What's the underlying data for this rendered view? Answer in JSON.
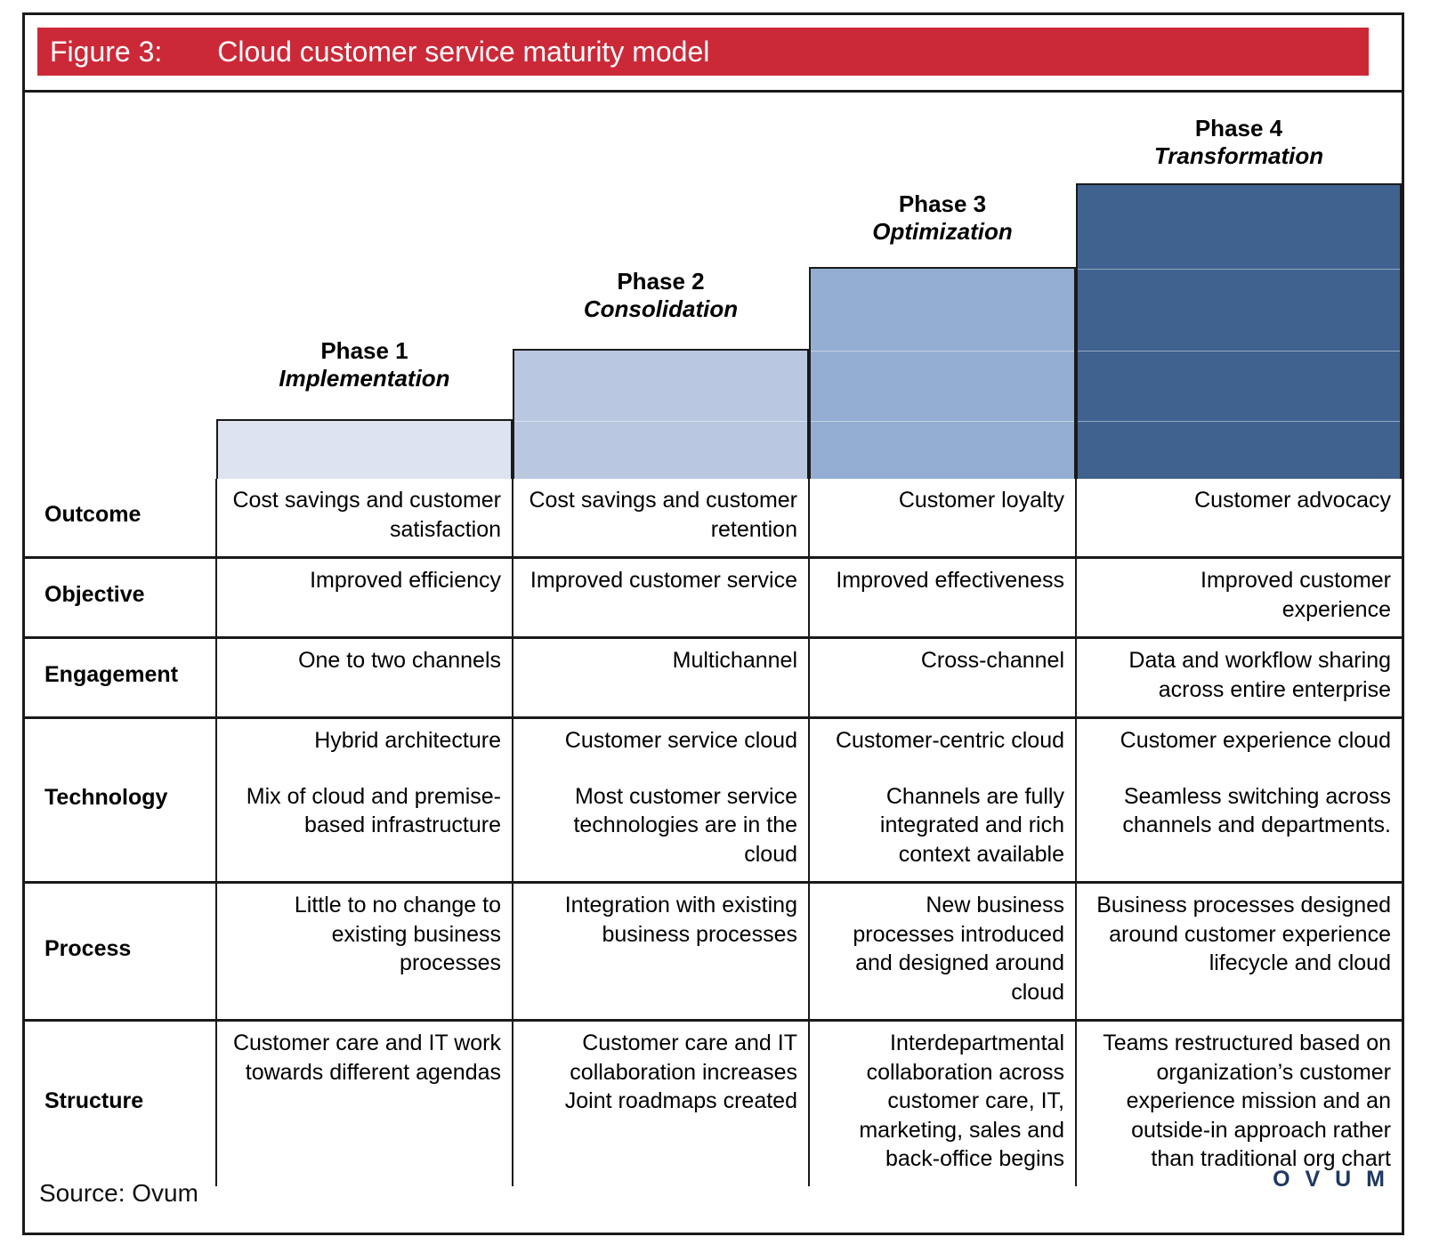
{
  "figure": {
    "label": "Figure 3:",
    "title": "Cloud customer service maturity model",
    "banner_color": "#cc2938"
  },
  "phases": [
    {
      "number": "Phase 1",
      "name": "Implementation",
      "color": "#dde3ef"
    },
    {
      "number": "Phase 2",
      "name": "Consolidation",
      "color": "#b9c8e0"
    },
    {
      "number": "Phase 3",
      "name": "Optimization",
      "color": "#93aed2"
    },
    {
      "number": "Phase 4",
      "name": "Transformation",
      "color": "#3f628f"
    }
  ],
  "rows": [
    {
      "label": "Outcome",
      "cells": [
        "Cost savings and customer satisfaction",
        "Cost savings and customer retention",
        "Customer loyalty",
        "Customer advocacy"
      ]
    },
    {
      "label": "Objective",
      "cells": [
        "Improved efficiency",
        "Improved customer service",
        "Improved effectiveness",
        "Improved customer experience"
      ]
    },
    {
      "label": "Engagement",
      "cells": [
        "One to two channels",
        "Multichannel",
        "Cross-channel",
        "Data and workflow sharing across entire enterprise"
      ]
    },
    {
      "label": "Technology",
      "cells_a": [
        "Hybrid architecture",
        "Customer service cloud",
        "Customer-centric cloud",
        "Customer experience cloud"
      ],
      "cells_b": [
        "Mix of cloud and premise-based infrastructure",
        "Most customer service technologies are in the cloud",
        "Channels are fully integrated and rich context available",
        "Seamless switching across channels and departments."
      ]
    },
    {
      "label": "Process",
      "cells": [
        "Little to no change to existing business processes",
        "Integration with existing business processes",
        "New business processes introduced and designed around cloud",
        "Business processes designed around customer experience lifecycle and cloud"
      ]
    },
    {
      "label": "Structure",
      "cells": [
        "Customer care and IT work towards different agendas",
        "Customer care and IT collaboration increases Joint roadmaps created",
        "Interdepartmental collaboration across customer care, IT, marketing, sales and back-office begins",
        "Teams restructured based on organization’s customer experience mission and an outside-in approach rather than traditional org chart"
      ]
    }
  ],
  "footer": {
    "source": "Source: Ovum",
    "logo": "O V U M",
    "logo_color": "#1f3864"
  }
}
